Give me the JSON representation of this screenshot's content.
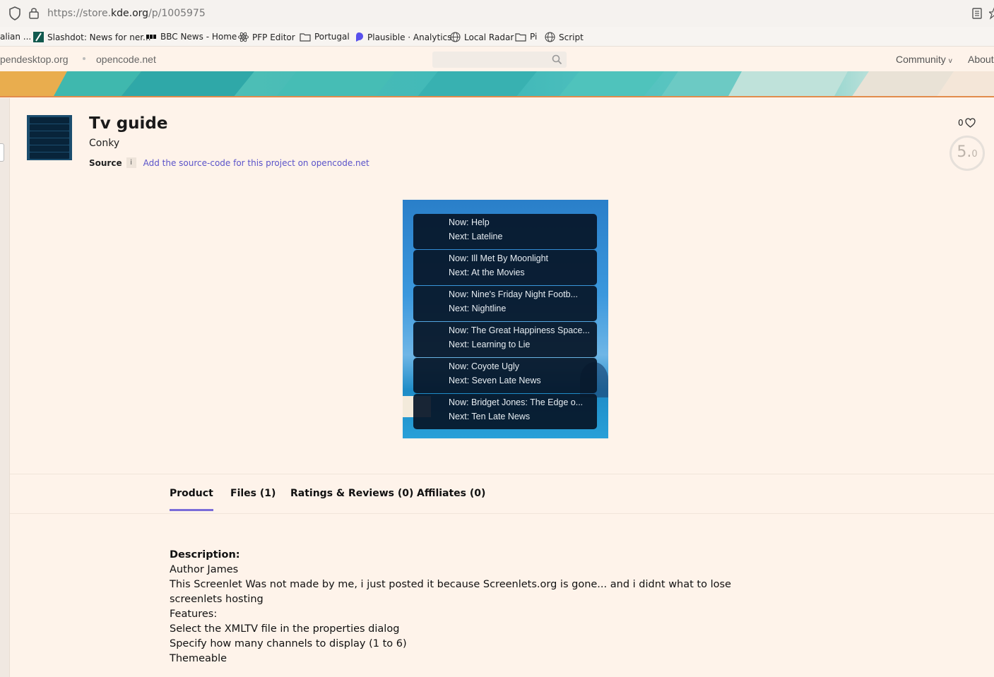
{
  "browser": {
    "url_prefix": "https://store.",
    "url_domain": "kde.org",
    "url_path": "/p/1005975"
  },
  "bookmarks": [
    {
      "label": "alian ...",
      "icon": "none"
    },
    {
      "label": "Slashdot: News for ner...",
      "icon": "slashdot-icon"
    },
    {
      "label": "BBC News - Home",
      "icon": "bbc-icon"
    },
    {
      "label": "PFP Editor",
      "icon": "react-icon"
    },
    {
      "label": "Portugal",
      "icon": "folder-icon"
    },
    {
      "label": "Plausible · Analytics",
      "icon": "plausible-icon"
    },
    {
      "label": "Local Radar",
      "icon": "globe-icon"
    },
    {
      "label": "Pi",
      "icon": "folder-icon"
    },
    {
      "label": "Script",
      "icon": "globe-icon"
    }
  ],
  "sitenav": {
    "link1": "pendesktop.org",
    "link2": "opencode.net",
    "community": "Community",
    "community_caret": "v",
    "about": "About"
  },
  "product": {
    "title": "Tv guide",
    "category": "Conky",
    "source_label": "Source",
    "info_badge": "i",
    "source_link": "Add the source-code for this project on opencode.net",
    "likes": "0",
    "score_big": "5.",
    "score_small": "0"
  },
  "preview": {
    "cards": [
      {
        "now": "Now: Help",
        "next": "Next: Lateline"
      },
      {
        "now": "Now: Ill Met By Moonlight",
        "next": "Next: At the Movies"
      },
      {
        "now": "Now: Nine's Friday Night Footb...",
        "next": "Next: Nightline"
      },
      {
        "now": "Now: The Great Happiness Space...",
        "next": "Next: Learning to Lie"
      },
      {
        "now": "Now: Coyote Ugly",
        "next": "Next: Seven Late News"
      },
      {
        "now": "Now: Bridget Jones: The Edge o...",
        "next": "Next: Ten Late News"
      }
    ]
  },
  "tabs": [
    {
      "label": "Product",
      "active": true
    },
    {
      "label": "Files (1)",
      "active": false
    },
    {
      "label": "Ratings & Reviews (0)",
      "active": false
    },
    {
      "label": "Affiliates (0)",
      "active": false
    }
  ],
  "description": {
    "heading": "Description:",
    "lines": [
      "Author James",
      "This Screenlet Was not made by me, i just posted it because Screenlets.org is gone... and i didnt what to lose",
      "screenlets hosting",
      "Features:",
      "Select the XMLTV file in the properties dialog",
      "Specify how many channels to display (1 to 6)",
      "Themeable"
    ]
  },
  "colors": {
    "page_bg": "#fef3ea",
    "accent": "#7a6cd8",
    "link": "#5a53c9",
    "banner_border": "#e28b4c"
  }
}
